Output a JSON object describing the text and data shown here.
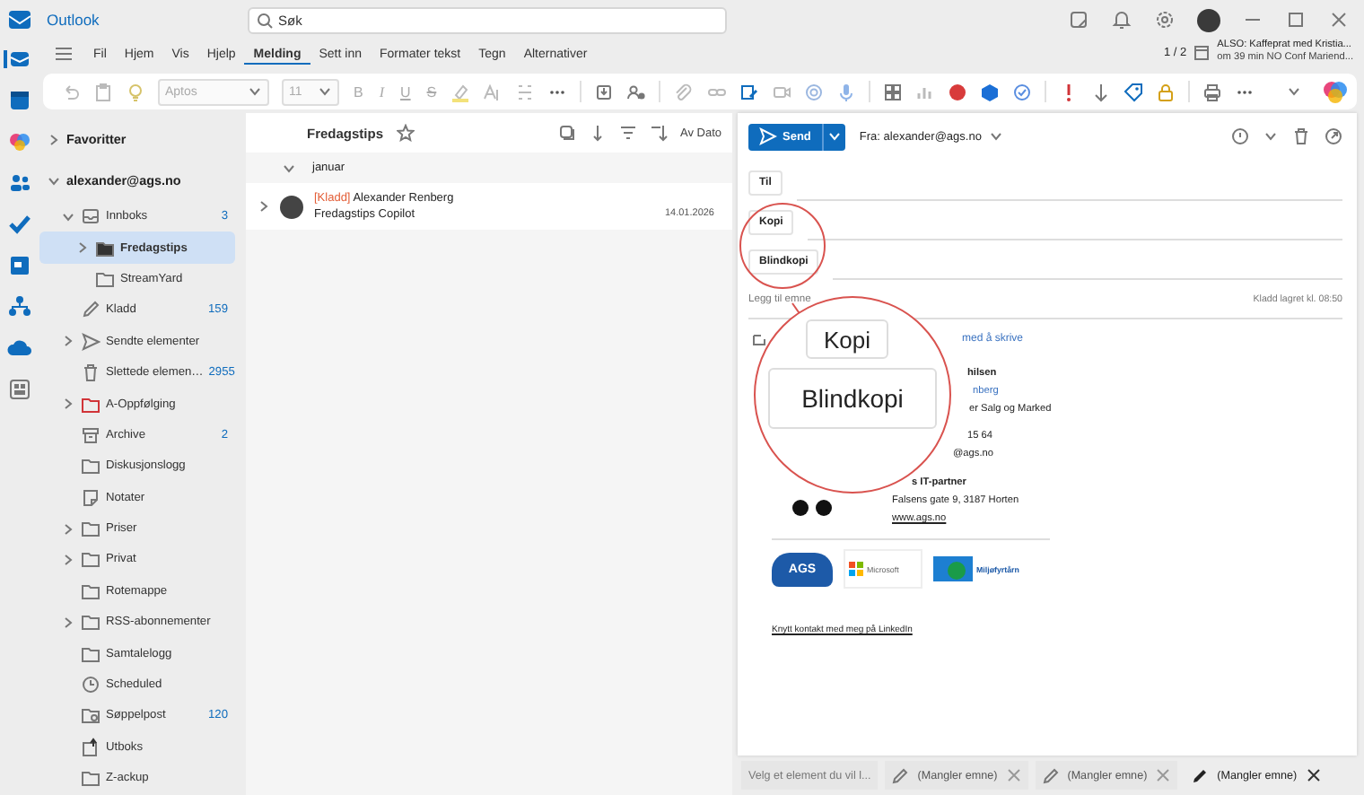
{
  "app": {
    "title": "Outlook"
  },
  "search": {
    "placeholder": "Søk"
  },
  "reminder": {
    "counter": "1 / 2",
    "title": "ALSO: Kaffeprat med Kristia...",
    "detail": "om 39 min NO Conf Mariend..."
  },
  "ribbon_tabs": [
    {
      "label": "Fil",
      "selected": false
    },
    {
      "label": "Hjem",
      "selected": false
    },
    {
      "label": "Vis",
      "selected": false
    },
    {
      "label": "Hjelp",
      "selected": false
    },
    {
      "label": "Melding",
      "selected": true
    },
    {
      "label": "Sett inn",
      "selected": false
    },
    {
      "label": "Formater tekst",
      "selected": false
    },
    {
      "label": "Tegn",
      "selected": false
    },
    {
      "label": "Alternativer",
      "selected": false
    }
  ],
  "toolbar": {
    "font": "Aptos",
    "size": "11",
    "format_buttons": [
      "B",
      "I",
      "U",
      "S"
    ]
  },
  "folders": [
    {
      "label": "Favoritter",
      "kind": "section",
      "expanded": false,
      "selected": false
    },
    {
      "label": "alexander@ags.no",
      "kind": "section",
      "expanded": true,
      "selected": false,
      "children": [
        {
          "label": "Innboks",
          "kind": "inbox",
          "count": "3",
          "expanded": true,
          "selected": false,
          "children": [
            {
              "label": "Fredagstips",
              "kind": "folder",
              "expanded": false,
              "selected": true
            },
            {
              "label": "StreamYard",
              "kind": "folder",
              "selected": false
            }
          ]
        },
        {
          "label": "Kladd",
          "kind": "drafts",
          "count": "159",
          "selected": false
        },
        {
          "label": "Sendte elementer",
          "kind": "sent",
          "expanded": false,
          "selected": false
        },
        {
          "label": "Slettede elemen…",
          "kind": "deleted",
          "count": "2955",
          "selected": false
        },
        {
          "label": "A-Oppfølging",
          "kind": "folder",
          "color": "#d13438",
          "expanded": false,
          "selected": false
        },
        {
          "label": "Archive",
          "kind": "archive",
          "count": "2",
          "selected": false
        },
        {
          "label": "Diskusjonslogg",
          "kind": "folder",
          "selected": false
        },
        {
          "label": "Notater",
          "kind": "notes",
          "selected": false
        },
        {
          "label": "Priser",
          "kind": "folder",
          "expanded": false,
          "selected": false
        },
        {
          "label": "Privat",
          "kind": "folder",
          "expanded": false,
          "selected": false
        },
        {
          "label": "Rotemappe",
          "kind": "folder",
          "selected": false
        },
        {
          "label": "RSS-abonnementer",
          "kind": "folder",
          "expanded": false,
          "selected": false
        },
        {
          "label": "Samtalelogg",
          "kind": "folder",
          "selected": false
        },
        {
          "label": "Scheduled",
          "kind": "scheduled",
          "selected": false
        },
        {
          "label": "Søppelpost",
          "kind": "junk",
          "count": "120",
          "selected": false
        },
        {
          "label": "Utboks",
          "kind": "outbox",
          "selected": false
        },
        {
          "label": "Z-ackup",
          "kind": "folder",
          "selected": false
        }
      ]
    }
  ],
  "message_list": {
    "title": "Fredagstips",
    "sort": "Av Dato",
    "groups": [
      {
        "label": "januar",
        "expanded": true,
        "messages": [
          {
            "tag": "[Kladd]",
            "sender": "Alexander Renberg",
            "subject": "Fredagstips Copilot",
            "date": "14.01.2026",
            "expanded": false
          }
        ]
      }
    ]
  },
  "compose": {
    "send": "Send",
    "from": "Fra: alexander@ags.no",
    "recipients": [
      {
        "label": "Til"
      },
      {
        "label": "Kopi"
      },
      {
        "label": "Blindkopi"
      }
    ],
    "subject": {
      "placeholder": "Legg til emne"
    },
    "saved": "Kladd lagret kl. 08:50",
    "copilot_hint": "med å skrive",
    "signature": {
      "closing": "hilsen",
      "name": "nberg",
      "role": "er Salg og Marked",
      "phone": "15 64",
      "email": "@ags.no",
      "company": "s IT-partner",
      "address": "Falsens gate 9, 3187 Horten",
      "website": "www.ags.no"
    },
    "logos": [
      {
        "kind": "ags",
        "text": "AGS"
      },
      {
        "kind": "microsoft",
        "text": "Microsoft"
      },
      {
        "kind": "eco",
        "text": "Miljøfyrtårn"
      }
    ],
    "linkedin": "Knytt kontakt med meg på LinkedIn"
  },
  "magnifier": {
    "labels": [
      "Kopi",
      "Blindkopi"
    ]
  },
  "bottom_tabs": [
    {
      "label": "Velg et element du vil l...",
      "kind": "placeholder",
      "selected": false
    },
    {
      "label": "(Mangler emne)",
      "kind": "draft",
      "selected": false
    },
    {
      "label": "(Mangler emne)",
      "kind": "draft",
      "selected": false
    },
    {
      "label": "(Mangler emne)",
      "kind": "draft",
      "selected": true
    }
  ]
}
